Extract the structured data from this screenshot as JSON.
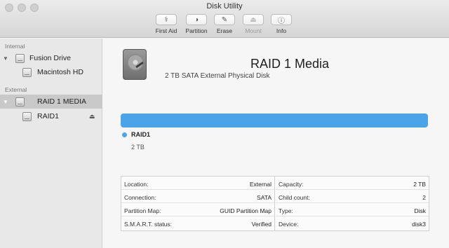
{
  "window": {
    "title": "Disk Utility"
  },
  "toolbar": {
    "items": [
      {
        "label": "First Aid",
        "icon": "stethoscope-icon",
        "enabled": true
      },
      {
        "label": "Partition",
        "icon": "partition-icon",
        "enabled": true
      },
      {
        "label": "Erase",
        "icon": "erase-icon",
        "enabled": true
      },
      {
        "label": "Mount",
        "icon": "mount-icon",
        "enabled": false
      },
      {
        "label": "Info",
        "icon": "info-icon",
        "enabled": true
      }
    ]
  },
  "sidebar": {
    "internal_header": "Internal",
    "external_header": "External",
    "items": [
      {
        "label": "Fusion Drive"
      },
      {
        "label": "Macintosh HD"
      },
      {
        "label": "RAID 1 MEDIA"
      },
      {
        "label": "RAID1"
      }
    ]
  },
  "main": {
    "disk_name": "RAID 1 Media",
    "disk_description": "2 TB SATA External Physical Disk",
    "volume_name": "RAID1",
    "volume_size": "2 TB",
    "bar_color": "#4ba3e8"
  },
  "info": {
    "left": [
      {
        "key": "Location:",
        "value": "External"
      },
      {
        "key": "Connection:",
        "value": "SATA"
      },
      {
        "key": "Partition Map:",
        "value": "GUID Partition Map"
      },
      {
        "key": "S.M.A.R.T. status:",
        "value": "Verified"
      }
    ],
    "right": [
      {
        "key": "Capacity:",
        "value": "2 TB"
      },
      {
        "key": "Child count:",
        "value": "2"
      },
      {
        "key": "Type:",
        "value": "Disk"
      },
      {
        "key": "Device:",
        "value": "disk3"
      }
    ]
  }
}
